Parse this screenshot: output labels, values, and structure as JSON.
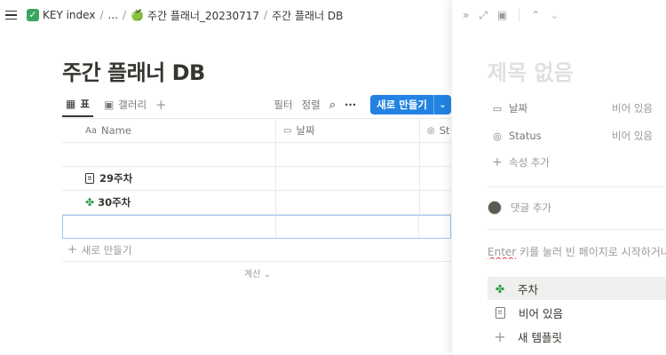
{
  "breadcrumb": {
    "items": [
      "KEY index",
      "...",
      "주간 플래너_20230717",
      "주간 플래너 DB"
    ]
  },
  "database": {
    "title": "주간 플래너 DB",
    "tabs": [
      {
        "label": "표",
        "icon": "table-icon",
        "active": true
      },
      {
        "label": "갤러리",
        "icon": "gallery-icon",
        "active": false
      }
    ],
    "toolbar": {
      "filter": "필터",
      "sort": "정렬",
      "new_label": "새로 만들기"
    },
    "columns": [
      {
        "label": "Name",
        "icon": "Aa"
      },
      {
        "label": "날짜",
        "icon": "calendar-icon"
      },
      {
        "label": "St",
        "icon": "status-icon"
      }
    ],
    "rows": [
      {
        "icon": "",
        "name": ""
      },
      {
        "icon": "page-icon",
        "name": "29주차"
      },
      {
        "icon": "clover-icon",
        "name": "30주차"
      },
      {
        "icon": "",
        "name": ""
      }
    ],
    "add_row": "새로 만들기",
    "calculate": "계산"
  },
  "peek": {
    "title_placeholder": "제목 없음",
    "properties": [
      {
        "label": "날짜",
        "icon": "calendar-icon",
        "value": "비어 있음"
      },
      {
        "label": "Status",
        "icon": "status-icon",
        "value": "비어 있음"
      }
    ],
    "add_property": "속성 추가",
    "comment_placeholder": "댓글 추가",
    "hint_key": "Enter",
    "hint_rest": " 키를 눌러 빈 페이지로 시작하거나",
    "templates": [
      {
        "label": "주차",
        "icon": "clover-icon",
        "highlighted": true
      },
      {
        "label": "비어 있음",
        "icon": "page-icon",
        "highlighted": false
      },
      {
        "label": "새 템플릿",
        "icon": "plus-icon",
        "highlighted": false
      }
    ]
  },
  "colors": {
    "accent": "#2383e2",
    "selected_border": "#9cc6f3",
    "highlight": "#efefed"
  }
}
